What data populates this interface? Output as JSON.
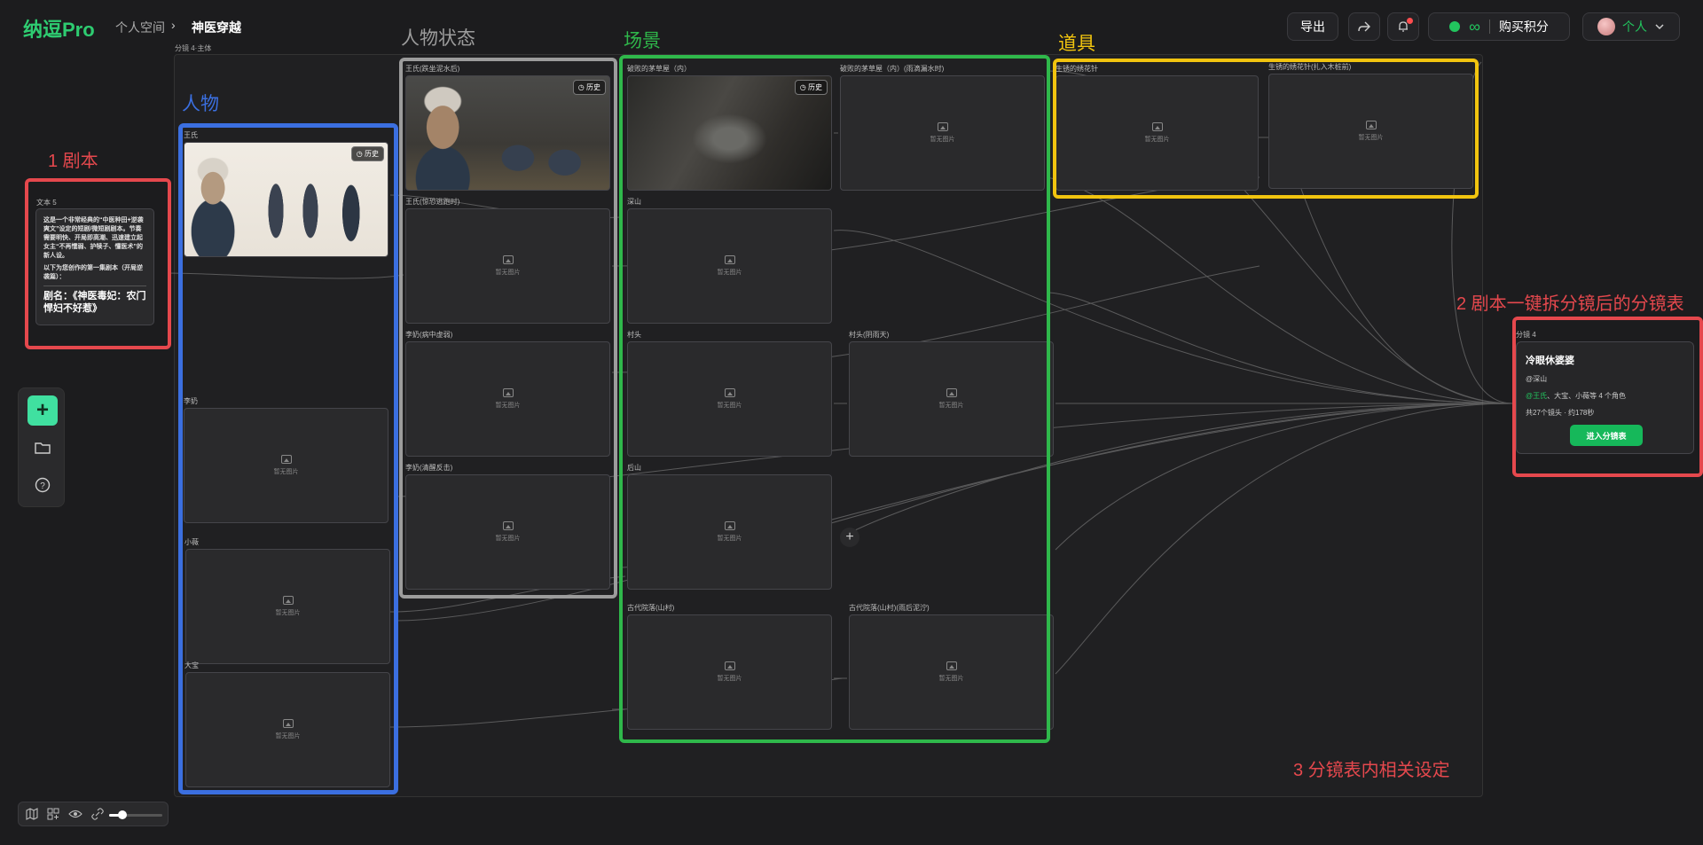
{
  "header": {
    "logo": "纳逗Pro",
    "breadcrumb_space": "个人空间",
    "breadcrumb_sep": "›",
    "breadcrumb_project": "神医穿越",
    "export_label": "导出",
    "infinity": "∞",
    "buy_credits_label": "购买积分",
    "user_label": "个人"
  },
  "canvas": {
    "group_label": "分镜 4·主体",
    "sections": {
      "characters": "人物",
      "character_states": "人物状态",
      "scenes": "场景",
      "props": "道具"
    },
    "placeholder_text": "暂无图片",
    "history_label": "历史",
    "characters": [
      {
        "name": "王氏",
        "has_image": true
      },
      {
        "name": "李奶",
        "has_image": false
      },
      {
        "name": "小薇",
        "has_image": false
      },
      {
        "name": "大宝",
        "has_image": false
      }
    ],
    "states": [
      {
        "name": "王氏(跌坐泥水后)",
        "has_image": true
      },
      {
        "name": "王氏(惊恐逃跑时)",
        "has_image": false
      },
      {
        "name": "李奶(病中虚弱)",
        "has_image": false
      },
      {
        "name": "李奶(清醒反击)",
        "has_image": false
      }
    ],
    "scenes": [
      {
        "name": "破败的茅草屋（内）",
        "has_image": true
      },
      {
        "name": "破败的茅草屋（内）(雨滴漏水时)",
        "has_image": false
      },
      {
        "name": "深山",
        "has_image": false
      },
      {
        "name": "村头",
        "has_image": false
      },
      {
        "name": "村头(阴雨天)",
        "has_image": false
      },
      {
        "name": "后山",
        "has_image": false
      },
      {
        "name": "古代院落(山村)",
        "has_image": false
      },
      {
        "name": "古代院落(山村)(雨后泥泞)",
        "has_image": false
      }
    ],
    "props": [
      {
        "name": "生锈的绣花针",
        "has_image": false
      },
      {
        "name": "生锈的绣花针(扎入木桩前)",
        "has_image": false
      }
    ]
  },
  "script": {
    "label": "文本 5",
    "paragraph1": "这是一个非常经典的“中医种田+逆袭爽文”设定的短剧/微短剧剧本。节奏需要明快、开局即高潮、迅速建立起女主“不再懦弱、护犊子、懂医术”的新人设。",
    "paragraph2": "以下为您创作的第一集剧本（开局逆袭篇）：",
    "title": "剧名：《神医毒妃：农门悍妇不好惹》"
  },
  "shot_table": {
    "label": "分镜 4",
    "title": "冷眼休婆婆",
    "scene": "@深山",
    "characters_highlight": "@王氏",
    "characters_rest": "、大宝、小薇等 4 个角色",
    "summary": "共27个镜头 · 约178秒",
    "enter_button": "进入分镜表"
  },
  "annotations": {
    "script": "1 剧本",
    "shot_table": "2 剧本一键拆分镜后的分镜表",
    "settings": "3 分镜表内相关设定"
  },
  "colors": {
    "accent_green": "#22c55e",
    "highlight_blue": "#3b6fe0",
    "highlight_gray": "#9c9c9c",
    "highlight_green": "#2fb84b",
    "highlight_yellow": "#f1c40f",
    "annotation_red": "#e5484d"
  },
  "zoom_level": 0.25,
  "icons": [
    "share-icon",
    "bell-icon",
    "bean-icon",
    "chevron-down-icon",
    "plus-icon",
    "folder-icon",
    "help-icon",
    "map-icon",
    "layout-icon",
    "eye-icon",
    "link-icon",
    "history-icon",
    "image-placeholder-icon"
  ]
}
